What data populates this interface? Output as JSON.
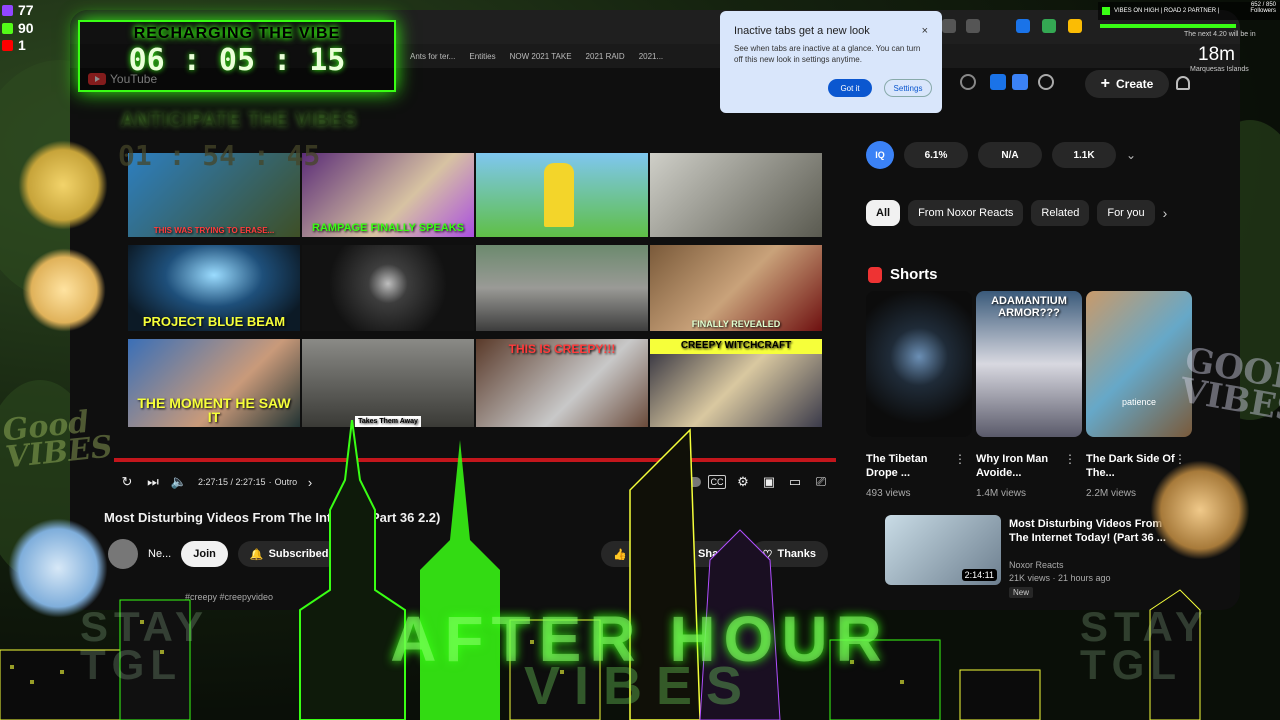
{
  "stream_stats": {
    "twitch_count": "77",
    "kick_count": "90",
    "youtube_count": "1",
    "colors": {
      "twitch": "#9146ff",
      "kick": "#53fc18",
      "youtube": "#ff0000"
    }
  },
  "timer": {
    "label": "RECHARGING THE VIBE",
    "value": "06 : 05 : 15"
  },
  "countdown": {
    "label": "ANTICIPATE THE VIBES",
    "value": "01 : 54 : 45"
  },
  "browser": {
    "bookmarks": [
      "Ants for ter...",
      "Entities",
      "NOW 2021 TAKE",
      "2021 RAID",
      "2021..."
    ],
    "youtube_logo_text": "YouTube",
    "create_label": "Create"
  },
  "popup": {
    "title": "Inactive tabs get a new look",
    "body": "See when tabs are inactive at a glance. You can turn off this new look in settings anytime.",
    "got_it": "Got it",
    "settings": "Settings",
    "close": "×"
  },
  "video_grid": {
    "thumbs": [
      {
        "caption": "THIS WAS TRYING TO ERASE..."
      },
      {
        "caption": "RAMPAGE FINALLY SPEAKS"
      },
      {
        "caption": ""
      },
      {
        "caption": ""
      },
      {
        "caption": "PROJECT BLUE BEAM"
      },
      {
        "caption": ""
      },
      {
        "caption": ""
      },
      {
        "caption": "FINALLY REVEALED"
      },
      {
        "caption": "THE MOMENT HE SAW IT"
      },
      {
        "caption": "Takes Them Away"
      },
      {
        "caption": "THIS IS CREEPY!!!"
      },
      {
        "caption": "CREEPY WITCHCRAFT"
      }
    ]
  },
  "player": {
    "time": "2:27:15 / 2:27:15",
    "chapter": "Outro",
    "title": "Most Disturbing Videos From The Internet (Part 36 2.2)",
    "channel_name": "Ne...",
    "join_label": "Join",
    "subscribed_label": "Subscribed",
    "share_label": "Share",
    "thanks_label": "Thanks",
    "description_tags": "#creepy #creepyvideo"
  },
  "stats_row": {
    "badge": "IQ",
    "values": [
      "6.1%",
      "N/A",
      "1.1K"
    ]
  },
  "filters": [
    "All",
    "From Noxor Reacts",
    "Related",
    "For you"
  ],
  "shorts": {
    "heading": "Shorts",
    "items": [
      {
        "title": "The Tibetan Drope ...",
        "views": "493 views",
        "caption": ""
      },
      {
        "title": "Why Iron Man Avoide...",
        "views": "1.4M views",
        "caption": "ADAMANTIUM ARMOR???"
      },
      {
        "title": "The Dark Side Of The...",
        "views": "2.2M views",
        "caption": "patience"
      }
    ]
  },
  "recommended": {
    "title": "Most Disturbing Videos From The Internet Today! (Part 36 ...",
    "channel": "Noxor Reacts",
    "meta": "21K views · 21 hours ago",
    "badge": "New",
    "duration": "2:14:11"
  },
  "top_right": {
    "title": "VIBES ON HIGH | ROAD 2 PARTNER |",
    "count": "652 / 850",
    "count_label": "Followers",
    "next": "The next 4.20 will be in",
    "distance": "18m",
    "location": "Marquesas Islands",
    "progress": 0.77
  },
  "overlay_text": {
    "after_hour": "AFTER HOUR",
    "vibes": "VIBES",
    "stay_tag_left": "STAY\nTGL",
    "stay_tag_right": "STAY\nTGL",
    "good_vibes_left": "Good\nVIBES",
    "good_vibes_right": "GOOD\nVIBES"
  }
}
